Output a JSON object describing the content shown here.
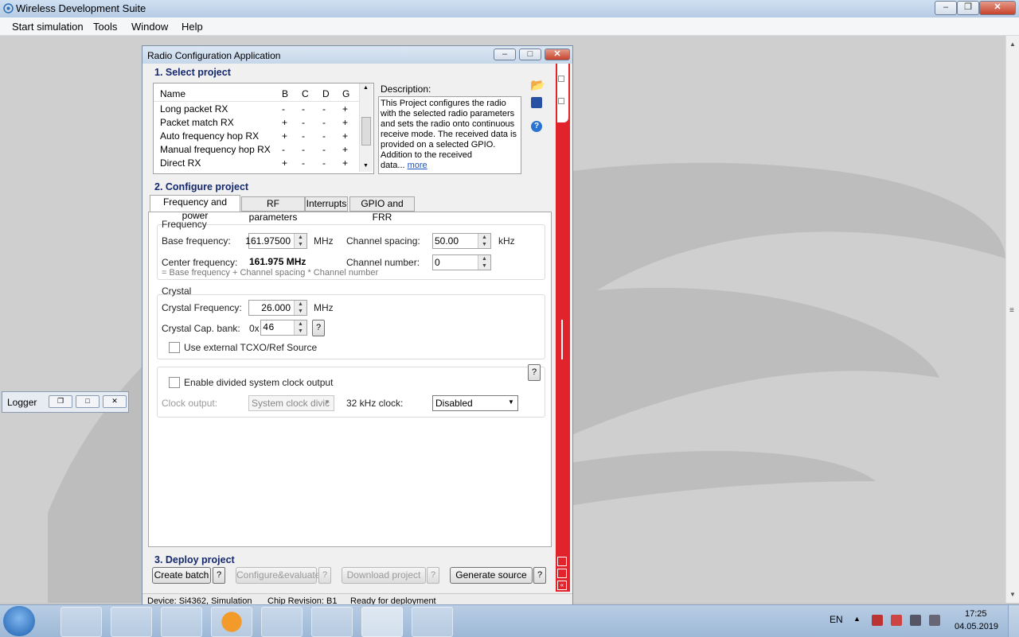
{
  "app": {
    "title": "Wireless Development Suite"
  },
  "menu": [
    "Start simulation",
    "Tools",
    "Window",
    "Help"
  ],
  "window": {
    "title": "Radio Configuration Application"
  },
  "logger": {
    "title": "Logger"
  },
  "select_project": {
    "heading": "1. Select project",
    "columns": [
      "Name",
      "B",
      "C",
      "D",
      "G"
    ],
    "rows": [
      {
        "name": "Long packet RX",
        "b": "-",
        "c": "-",
        "d": "-",
        "g": "+"
      },
      {
        "name": "Packet match RX",
        "b": "+",
        "c": "-",
        "d": "-",
        "g": "+"
      },
      {
        "name": "Auto frequency hop RX",
        "b": "+",
        "c": "-",
        "d": "-",
        "g": "+"
      },
      {
        "name": "Manual frequency hop RX",
        "b": "-",
        "c": "-",
        "d": "-",
        "g": "+"
      },
      {
        "name": "Direct RX",
        "b": "+",
        "c": "-",
        "d": "-",
        "g": "+"
      }
    ],
    "description_label": "Description:",
    "description_lines": [
      "This Project configures the radio",
      "with the selected radio parameters",
      "and sets the radio onto continuous",
      "receive mode. The received data is",
      "provided on a selected GPIO.",
      "Addition to the received data..."
    ],
    "more_link": "more"
  },
  "configure": {
    "heading": "2. Configure project",
    "tabs": [
      "Frequency and power",
      "RF parameters",
      "Interrupts",
      "GPIO and FRR"
    ],
    "frequency": {
      "group_label": "Frequency",
      "base_label": "Base frequency:",
      "base_value": "161.97500",
      "base_unit": "MHz",
      "spacing_label": "Channel spacing:",
      "spacing_value": "50.00",
      "spacing_unit": "kHz",
      "center_label": "Center frequency:",
      "center_value": "161.975 MHz",
      "channel_label": "Channel number:",
      "channel_value": "0",
      "formula": "= Base frequency + Channel spacing * Channel number"
    },
    "crystal": {
      "group_label": "Crystal",
      "freq_label": "Crystal Frequency:",
      "freq_value": "26.000",
      "freq_unit": "MHz",
      "cap_label": "Crystal Cap. bank:",
      "cap_prefix": "0x",
      "cap_value": "46",
      "tcxo_label": "Use external TCXO/Ref Source"
    },
    "clock": {
      "enable_label": "Enable divided system clock output",
      "output_label": "Clock output:",
      "output_value": "System clock divic",
      "khz_label": "32 kHz clock:",
      "khz_value": "Disabled"
    },
    "help_label": "?"
  },
  "deploy": {
    "heading": "3. Deploy project",
    "buttons": [
      "Create batch",
      "Configure&evaluate",
      "Download project",
      "Generate source"
    ]
  },
  "status": {
    "device": "Device: Si4362, Simulation",
    "chip": "Chip Revision: B1",
    "state": "Ready for deployment"
  },
  "taskbar": {
    "lang": "EN",
    "time": "17:25",
    "date": "04.05.2019"
  },
  "colors": {
    "accent_red": "#e1232c",
    "heading_blue": "#14286e"
  }
}
